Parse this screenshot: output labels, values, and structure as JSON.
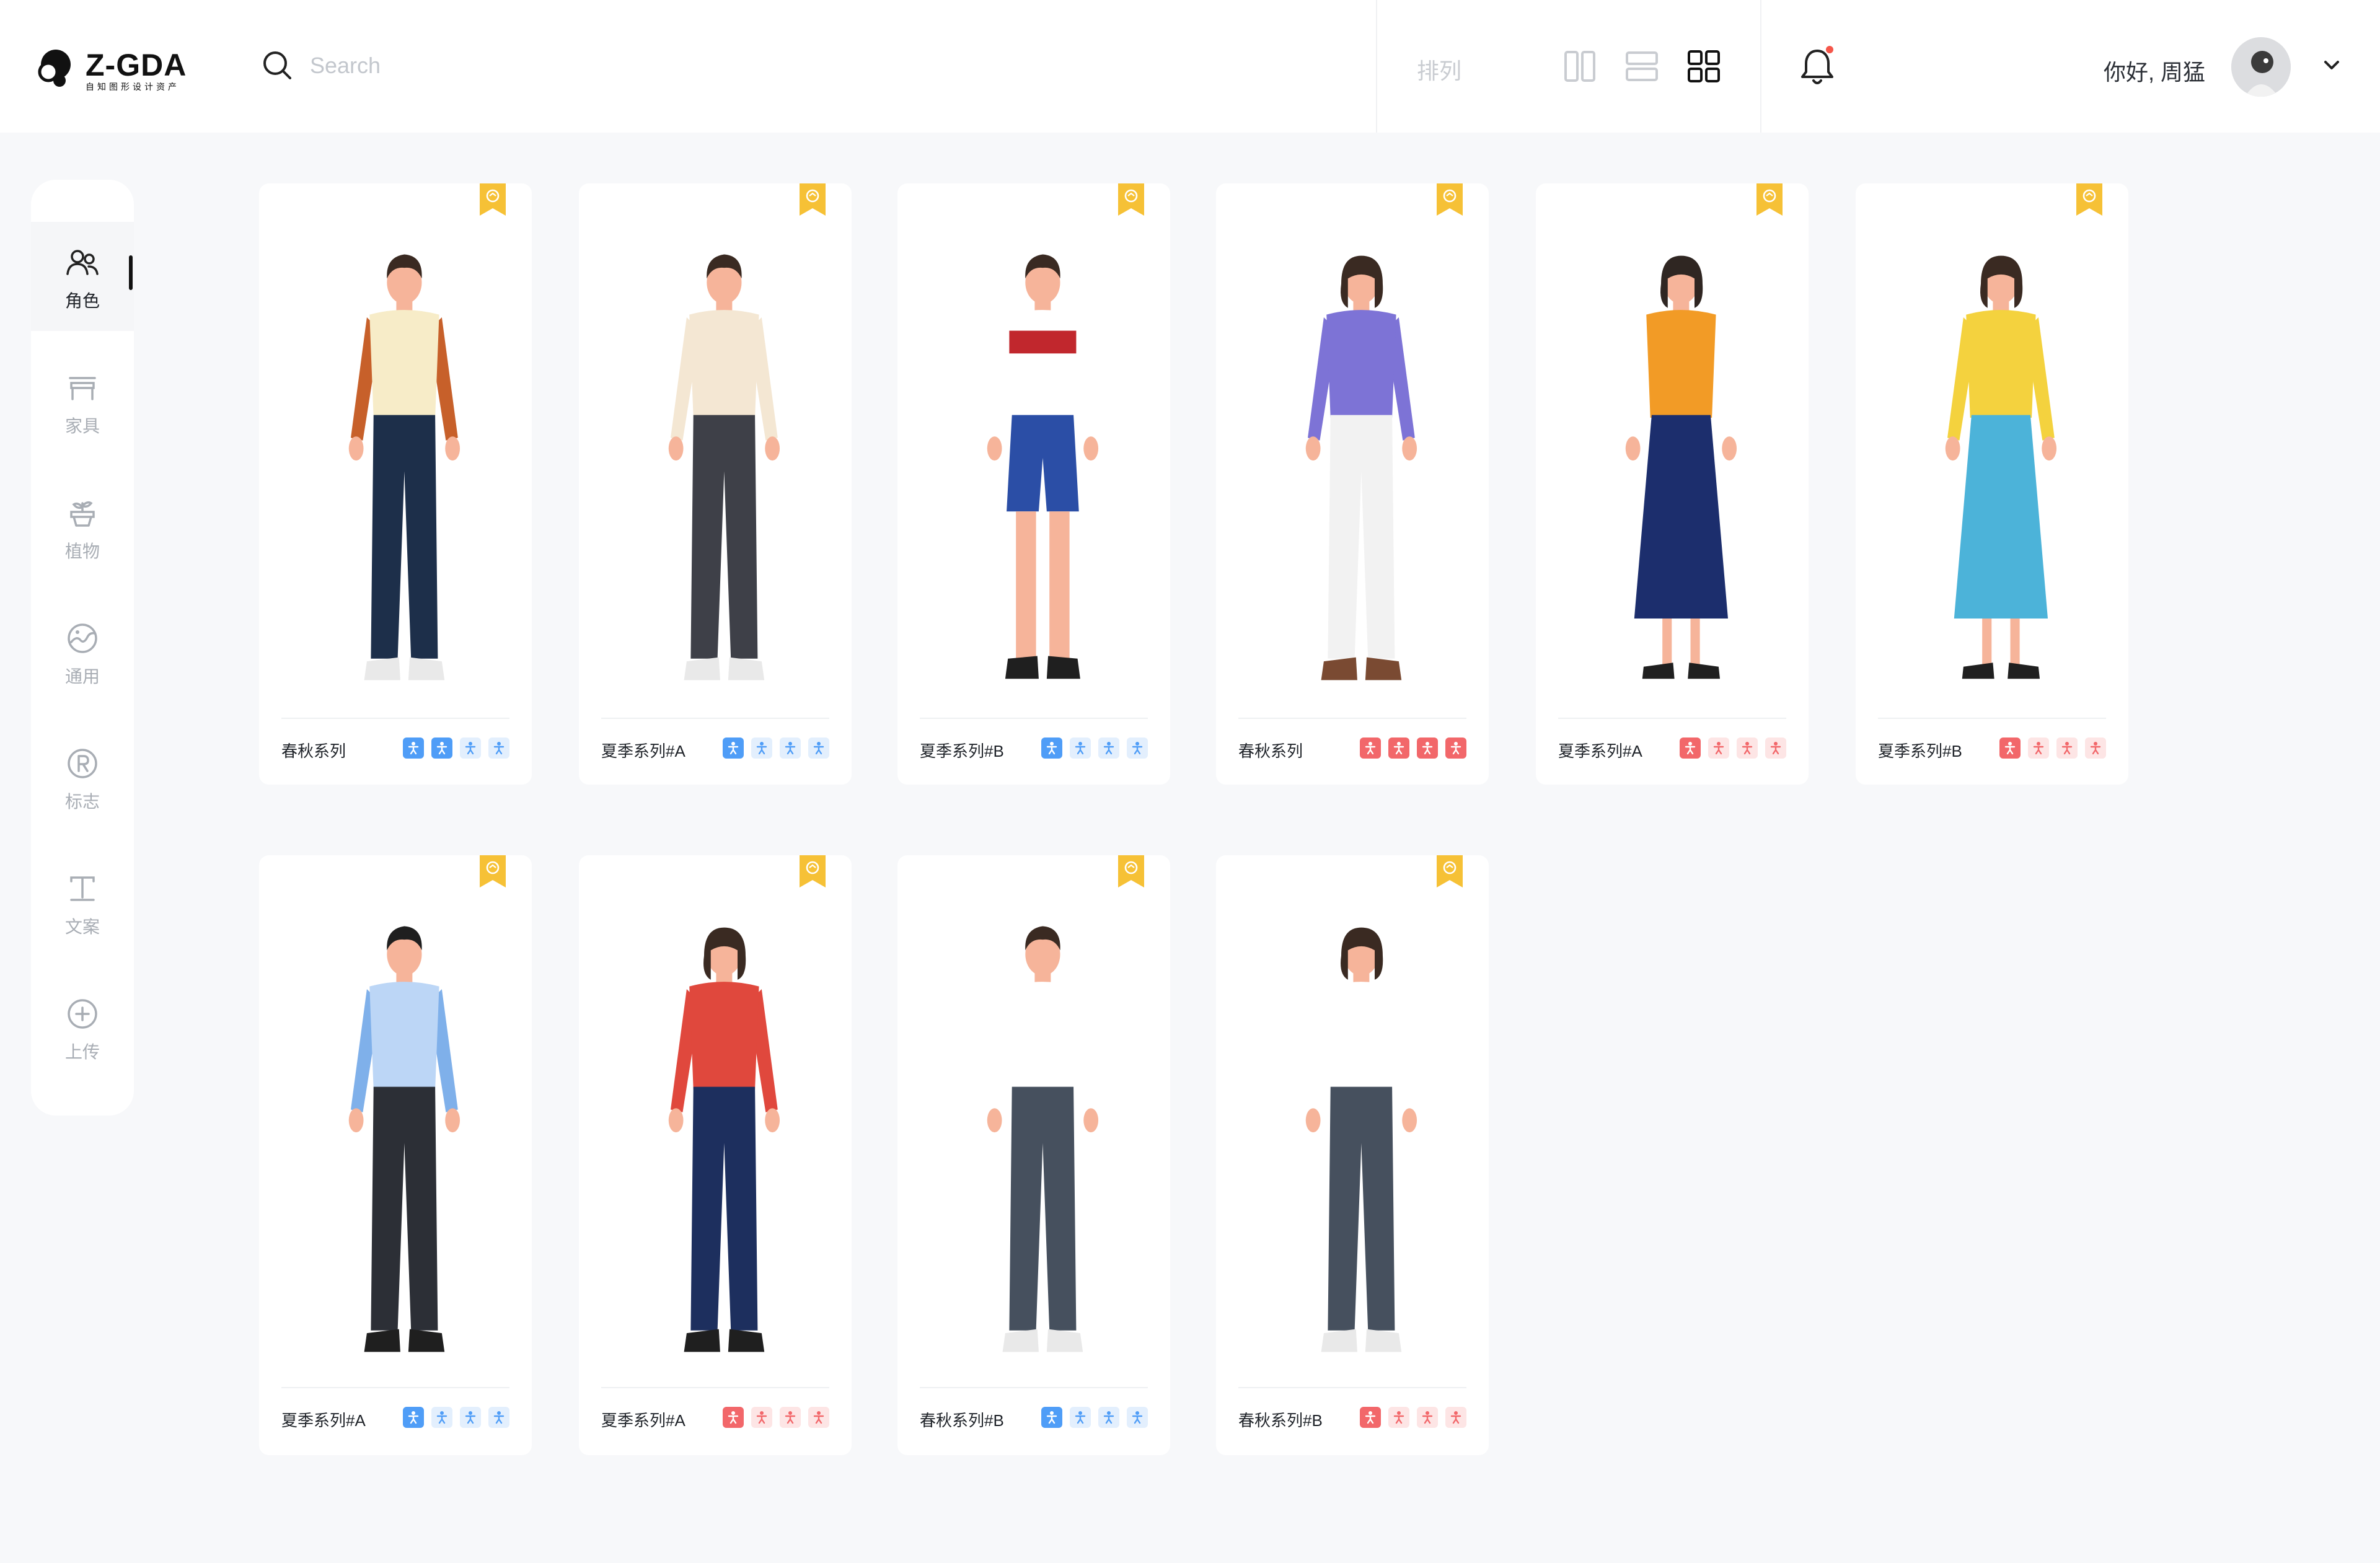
{
  "brand": {
    "name": "Z-GDA",
    "tagline": "自知图形设计资产"
  },
  "search": {
    "placeholder": "Search",
    "value": ""
  },
  "toolbar": {
    "sort_label": "排列",
    "view_modes": [
      "two-column-view",
      "list-view",
      "grid-view"
    ],
    "active_view": "grid-view",
    "notification_dot_color": "#f5564a"
  },
  "user": {
    "greeting": "你好, 周猛"
  },
  "sidebar": {
    "items": [
      {
        "label": "角色",
        "icon": "person-group-icon",
        "active": true
      },
      {
        "label": "家具",
        "icon": "table-icon",
        "active": false
      },
      {
        "label": "植物",
        "icon": "plant-pot-icon",
        "active": false
      },
      {
        "label": "通用",
        "icon": "globe-icon",
        "active": false
      },
      {
        "label": "标志",
        "icon": "registered-mark-icon",
        "active": false
      },
      {
        "label": "文案",
        "icon": "text-icon",
        "active": false
      },
      {
        "label": "上传",
        "icon": "add-circle-icon",
        "active": false
      }
    ]
  },
  "colors": {
    "accent_blue": "#4f9df7",
    "accent_red": "#f2676a",
    "badge_yellow": "#f6c136"
  },
  "cards": [
    {
      "title": "春秋系列",
      "chips": "blue",
      "active_chips": 2,
      "icon": "premium-badge-icon"
    },
    {
      "title": "夏季系列#A",
      "chips": "blue",
      "active_chips": 1,
      "icon": "premium-badge-icon"
    },
    {
      "title": "夏季系列#B",
      "chips": "blue",
      "active_chips": 1,
      "icon": "premium-badge-icon"
    },
    {
      "title": "春秋系列",
      "chips": "red",
      "active_chips": 4,
      "icon": "premium-badge-icon"
    },
    {
      "title": "夏季系列#A",
      "chips": "red",
      "active_chips": 1,
      "icon": "premium-badge-icon"
    },
    {
      "title": "夏季系列#B",
      "chips": "red",
      "active_chips": 1,
      "icon": "premium-badge-icon"
    },
    {
      "title": "夏季系列#A",
      "chips": "blue",
      "active_chips": 1,
      "icon": "premium-badge-icon"
    },
    {
      "title": "夏季系列#A",
      "chips": "red",
      "active_chips": 1,
      "icon": "premium-badge-icon"
    },
    {
      "title": "春秋系列#B",
      "chips": "blue",
      "active_chips": 1,
      "icon": "premium-badge-icon"
    },
    {
      "title": "春秋系列#B",
      "chips": "red",
      "active_chips": 1,
      "icon": "premium-badge-icon"
    }
  ]
}
